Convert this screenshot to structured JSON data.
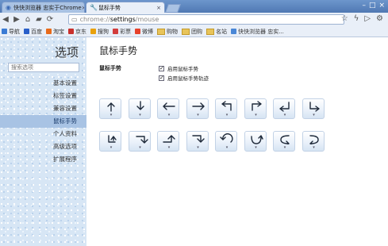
{
  "tabs": [
    {
      "label": "快快浏览器 忠实于Chrome",
      "active": false
    },
    {
      "label": "鼠标手势",
      "active": true
    }
  ],
  "address_bar": {
    "url_scheme": "chrome://",
    "url_host": "settings",
    "url_path": "/mouse"
  },
  "bookmarks": [
    {
      "label": "导航",
      "icon": "nav-icon",
      "color": "#3b7bd4"
    },
    {
      "label": "百度",
      "icon": "baidu-icon",
      "color": "#2a5fc9"
    },
    {
      "label": "淘宝",
      "icon": "taobao-icon",
      "color": "#e86a1a"
    },
    {
      "label": "京东",
      "icon": "jd-icon",
      "color": "#c9302c"
    },
    {
      "label": "搜狗",
      "icon": "sogou-icon",
      "color": "#e9a10c"
    },
    {
      "label": "彩票",
      "icon": "lottery-icon",
      "color": "#d23c3c"
    },
    {
      "label": "微博",
      "icon": "weibo-icon",
      "color": "#e6412b"
    },
    {
      "label": "购物",
      "icon": "folder-icon",
      "color": "#e8c45a"
    },
    {
      "label": "团购",
      "icon": "folder-icon",
      "color": "#e8c45a"
    },
    {
      "label": "名站",
      "icon": "folder-icon",
      "color": "#e8c45a"
    },
    {
      "label": "快快浏览器 忠实...",
      "icon": "browser-icon",
      "color": "#4a87d6"
    }
  ],
  "sidebar": {
    "title": "选项",
    "search_placeholder": "搜索选项",
    "items": [
      {
        "label": "基本设置",
        "selected": false
      },
      {
        "label": "标签设置",
        "selected": false
      },
      {
        "label": "兼容设置",
        "selected": false
      },
      {
        "label": "鼠标手势",
        "selected": true
      },
      {
        "label": "个人资料",
        "selected": false
      },
      {
        "label": "高级选项",
        "selected": false
      },
      {
        "label": "扩展程序",
        "selected": false
      }
    ]
  },
  "main": {
    "title": "鼠标手势",
    "section_label": "鼠标手势",
    "options": [
      {
        "label": "启用鼠标手势",
        "checked": true
      },
      {
        "label": "启用鼠标手势轨迹",
        "checked": true
      }
    ],
    "gestures": [
      "up",
      "down",
      "left",
      "right",
      "up-left",
      "up-right",
      "left-down-left",
      "down-right",
      "down-up",
      "up-down",
      "right-up",
      "right-down",
      "rotate-counterclockwise",
      "u-turn",
      "curve-left",
      "curve-return"
    ]
  },
  "colors": {
    "accent": "#4f78b3",
    "sidebar_bg": "#d7e6f5",
    "selected_item": "#a8c3e4"
  }
}
